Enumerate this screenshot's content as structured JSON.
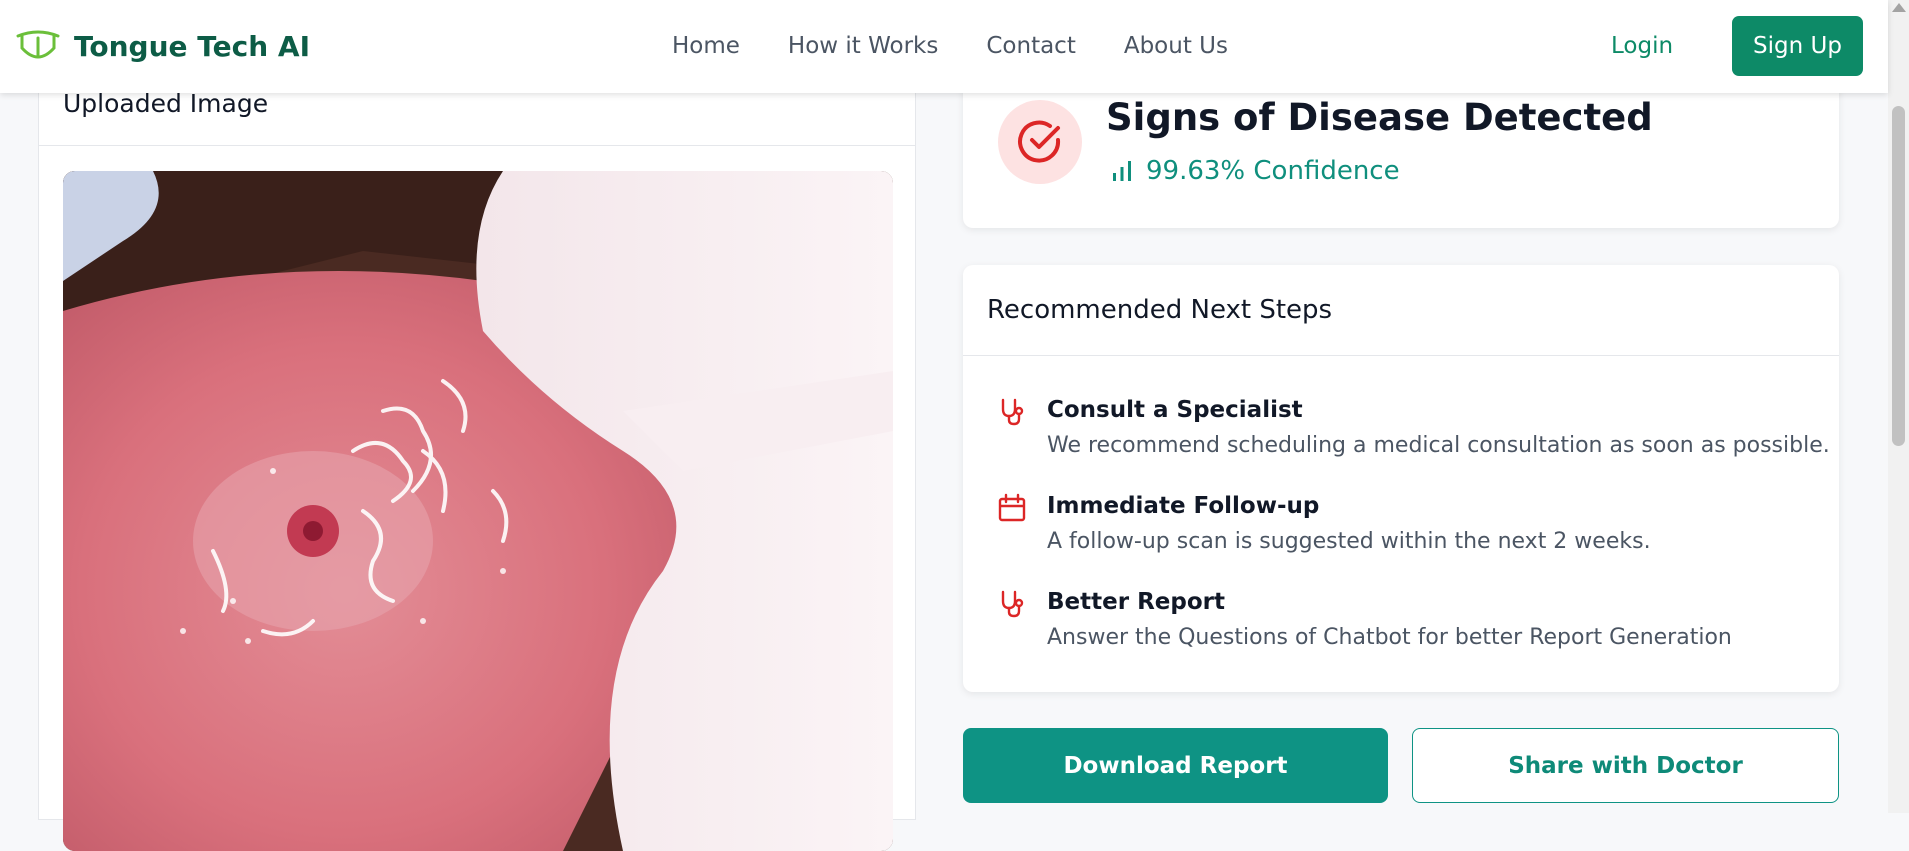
{
  "navbar": {
    "brand": "Tongue Tech AI",
    "links": [
      "Home",
      "How it Works",
      "Contact",
      "About Us"
    ],
    "login": "Login",
    "signup": "Sign Up"
  },
  "uploaded": {
    "title": "Uploaded Image"
  },
  "result": {
    "title": "Signs of Disease Detected",
    "confidence": "99.63% Confidence"
  },
  "steps": {
    "title": "Recommended Next Steps",
    "items": [
      {
        "icon": "stethoscope-icon",
        "title": "Consult a Specialist",
        "desc": "We recommend scheduling a medical consultation as soon as possible."
      },
      {
        "icon": "calendar-icon",
        "title": "Immediate Follow-up",
        "desc": "A follow-up scan is suggested within the next 2 weeks."
      },
      {
        "icon": "stethoscope-icon",
        "title": "Better Report",
        "desc": "Answer the Questions of Chatbot for better Report Generation"
      }
    ]
  },
  "actions": {
    "download": "Download Report",
    "share": "Share with Doctor"
  },
  "colors": {
    "brand": "#0d5c46",
    "accent": "#0e9384",
    "danger": "#dc2626",
    "danger_bg": "#fde2e2"
  }
}
